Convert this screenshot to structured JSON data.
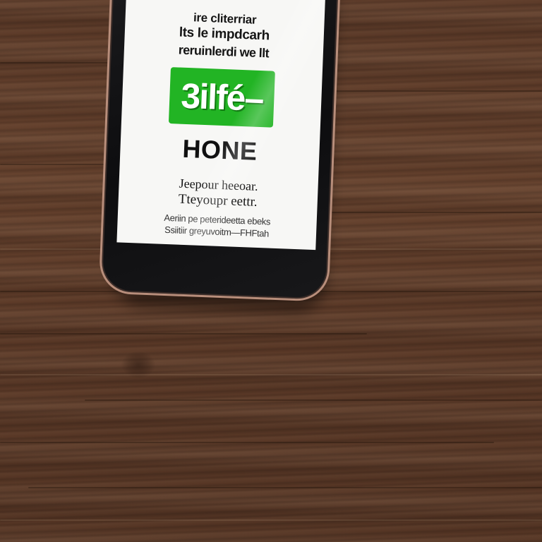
{
  "phone_screen": {
    "header_lines": [
      "ire cliterriar",
      "lts le impdcarh",
      "reruinlerdi we llt"
    ],
    "logo_text": "3ilfé–",
    "title": "HONE",
    "subtitle_lines": [
      "Jeepour heeoar.",
      "Tteyoupr eettr."
    ],
    "small_lines": [
      "Аeriin pe peterideetta ebeks",
      "Ssiitiir greyuvoitm—FHFtah"
    ]
  },
  "colors": {
    "logo_green": "#22b424",
    "table_wood": "#5a3826",
    "phone_frame": "#b88e7b"
  }
}
